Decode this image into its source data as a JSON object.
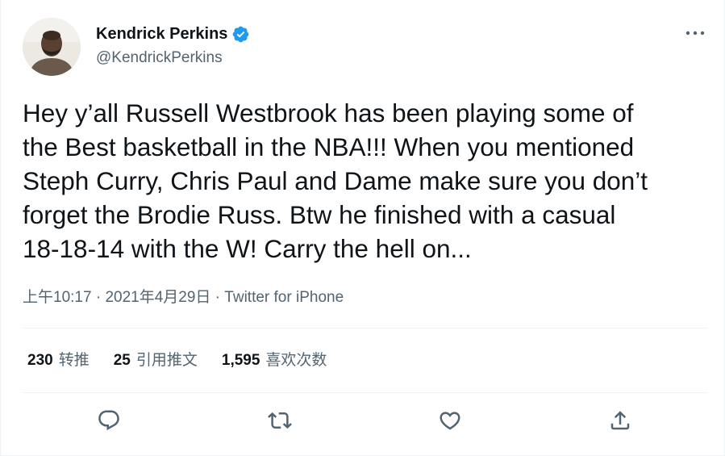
{
  "author": {
    "display_name": "Kendrick Perkins",
    "handle": "@KendrickPerkins",
    "verified": true
  },
  "tweet": {
    "text": "Hey y’all Russell Westbrook has been playing some of\nthe Best basketball in the NBA!!! When you mentioned\nSteph Curry, Chris Paul and Dame make sure you don’t\nforget the Brodie Russ. Btw he finished with a casual\n18-18-14 with the W! Carry the hell on...",
    "time": "上午10:17",
    "separator": " · ",
    "date": "2021年4月29日",
    "source": "Twitter for iPhone"
  },
  "stats": {
    "retweets_count": "230",
    "retweets_label": "转推",
    "quotes_count": "25",
    "quotes_label": "引用推文",
    "likes_count": "1,595",
    "likes_label": "喜欢次数"
  },
  "icons": {
    "more": "more-dots-icon",
    "verified": "verified-badge-icon",
    "reply": "reply-icon",
    "retweet": "retweet-icon",
    "like": "heart-icon",
    "share": "share-icon"
  },
  "colors": {
    "text_primary": "#0f1419",
    "text_secondary": "#536471",
    "verified_blue": "#1d9bf0",
    "divider": "#eff3f4"
  }
}
